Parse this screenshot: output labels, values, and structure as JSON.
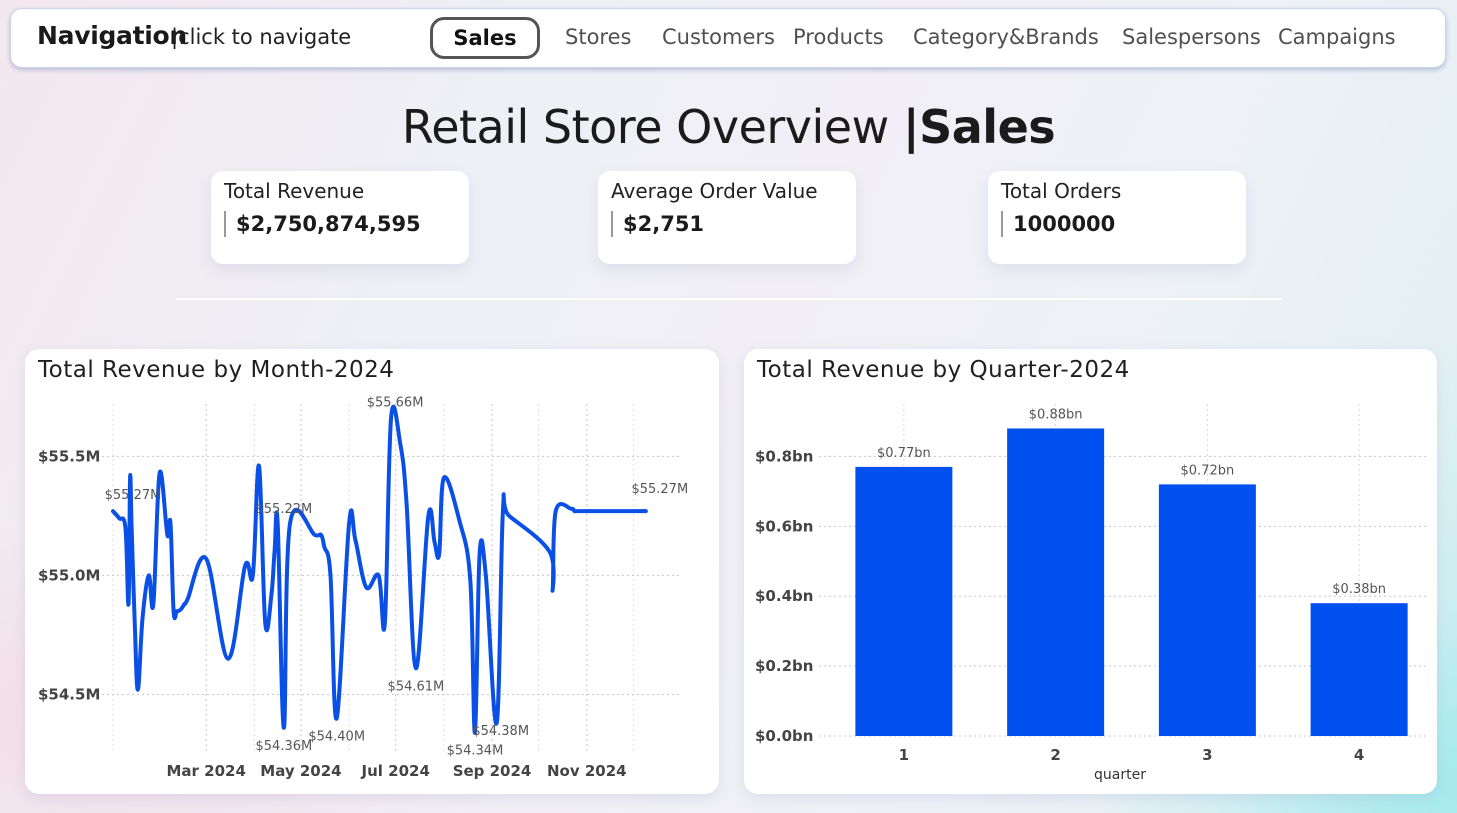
{
  "nav": {
    "title": "Navigation",
    "hint": "|click to navigate",
    "active": "Sales",
    "links": [
      "Stores",
      "Customers",
      "Products",
      "Category&Brands",
      "Salespersons",
      "Campaigns"
    ]
  },
  "page": {
    "title_main": "Retail Store Overview ",
    "title_bold": "|Sales"
  },
  "kpis": [
    {
      "label": "Total Revenue",
      "value": "$2,750,874,595"
    },
    {
      "label": "Average Order Value",
      "value": "$2,751"
    },
    {
      "label": "Total Orders",
      "value": "1000000"
    }
  ],
  "colors": {
    "accent": "#0a50e6",
    "bar": "#0050f0"
  },
  "chart_data": [
    {
      "type": "line",
      "title": "Total Revenue by Month-2024",
      "xlabel": "",
      "ylabel": "",
      "x_ticks": [
        "Mar 2024",
        "May 2024",
        "Jul 2024",
        "Sep 2024",
        "Nov 2024"
      ],
      "y_ticks": [
        "$54.5M",
        "$55.0M",
        "$55.5M"
      ],
      "ylim": [
        54.25,
        55.72
      ],
      "grid": true,
      "x": [
        "2024-01-01",
        "2024-01-05",
        "2024-01-09",
        "2024-01-11",
        "2024-01-12",
        "2024-01-13",
        "2024-01-15",
        "2024-01-17",
        "2024-01-20",
        "2024-01-24",
        "2024-01-27",
        "2024-01-31",
        "2024-02-05",
        "2024-02-07",
        "2024-02-09",
        "2024-02-11",
        "2024-02-12",
        "2024-02-14",
        "2024-02-16",
        "2024-02-18",
        "2024-03-01",
        "2024-03-15",
        "2024-03-26",
        "2024-03-31",
        "2024-04-04",
        "2024-04-08",
        "2024-04-12",
        "2024-04-14",
        "2024-04-16",
        "2024-04-20",
        "2024-04-24",
        "2024-05-10",
        "2024-05-14",
        "2024-05-16",
        "2024-05-20",
        "2024-05-24",
        "2024-06-01",
        "2024-06-05",
        "2024-06-12",
        "2024-06-20",
        "2024-06-24",
        "2024-06-28",
        "2024-07-04",
        "2024-07-08",
        "2024-07-14",
        "2024-07-22",
        "2024-07-26",
        "2024-07-29",
        "2024-08-01",
        "2024-08-11",
        "2024-08-18",
        "2024-08-21",
        "2024-08-24",
        "2024-08-28",
        "2024-09-04",
        "2024-09-08",
        "2024-09-12",
        "2024-10-08",
        "2024-10-10",
        "2024-10-12",
        "2024-10-22",
        "2024-10-24",
        "2024-10-26",
        "2024-10-29",
        "2024-11-03",
        "2024-11-18",
        "2024-11-30",
        "2024-12-09"
      ],
      "values": [
        55.27,
        55.24,
        55.2,
        54.88,
        55.41,
        55.2,
        54.8,
        54.52,
        54.82,
        55.0,
        54.88,
        55.43,
        55.17,
        55.22,
        54.85,
        54.85,
        54.85,
        54.86,
        54.88,
        54.9,
        55.07,
        54.65,
        55.04,
        55.0,
        55.46,
        54.8,
        54.92,
        55.1,
        55.22,
        54.36,
        55.22,
        55.17,
        55.17,
        55.12,
        55.0,
        54.4,
        55.22,
        55.15,
        54.95,
        55.0,
        54.8,
        55.66,
        55.55,
        55.3,
        54.61,
        55.25,
        55.14,
        55.09,
        55.41,
        55.23,
        54.98,
        54.34,
        55.09,
        55.0,
        54.38,
        55.27,
        55.25,
        55.1,
        54.94,
        55.27,
        55.28,
        55.27,
        55.27,
        55.27,
        55.27,
        55.27,
        55.27,
        55.27
      ],
      "labels": [
        {
          "text": "$55.27M"
        },
        {
          "text": "$55.22M"
        },
        {
          "text": "$54.36M"
        },
        {
          "text": "$54.40M"
        },
        {
          "text": "$55.66M"
        },
        {
          "text": "$54.61M"
        },
        {
          "text": "$54.34M"
        },
        {
          "text": "$54.38M"
        },
        {
          "text": "$55.27M"
        }
      ]
    },
    {
      "type": "bar",
      "title": "Total Revenue by Quarter-2024",
      "xlabel": "quarter",
      "ylabel": "",
      "categories": [
        "1",
        "2",
        "3",
        "4"
      ],
      "values": [
        0.77,
        0.88,
        0.72,
        0.38
      ],
      "value_labels": [
        "$0.77bn",
        "$0.88bn",
        "$0.72bn",
        "$0.38bn"
      ],
      "y_ticks": [
        "$0.0bn",
        "$0.2bn",
        "$0.4bn",
        "$0.6bn",
        "$0.8bn"
      ],
      "ylim": [
        0,
        0.95
      ],
      "grid": true
    }
  ]
}
